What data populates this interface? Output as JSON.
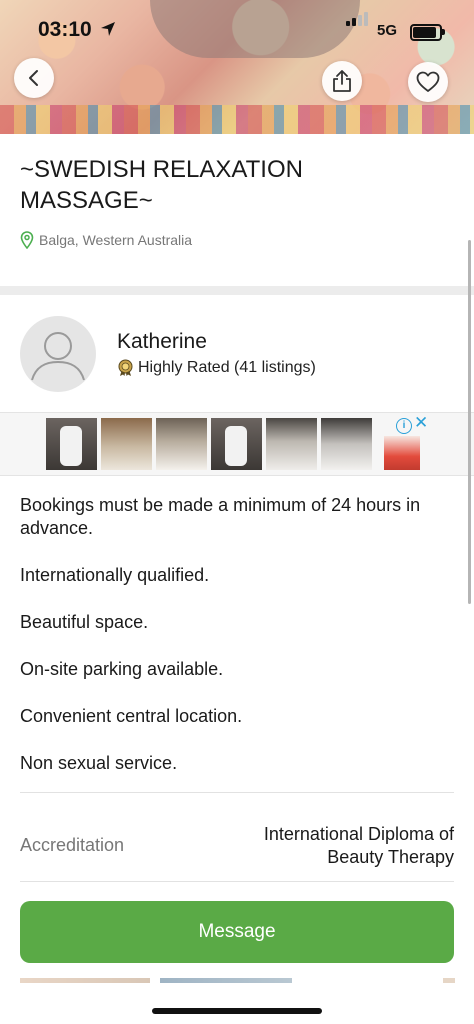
{
  "status_bar": {
    "time": "03:10",
    "network": "5G"
  },
  "listing": {
    "title": "~SWEDISH RELAXATION MASSAGE~",
    "location": "Balga, Western Australia"
  },
  "seller": {
    "name": "Katherine",
    "rating_text": "Highly Rated (41 listings)"
  },
  "ad": {
    "choices_label": "i",
    "close_label": "✕"
  },
  "description": [
    "Bookings must be made a minimum of 24 hours in advance.",
    "Internationally qualified.",
    "Beautiful space.",
    "On-site parking available.",
    "Convenient central location.",
    "Non sexual service."
  ],
  "attributes": {
    "accreditation_label": "Accreditation",
    "accreditation_value": "International Diploma of Beauty Therapy"
  },
  "actions": {
    "message_label": "Message"
  },
  "colors": {
    "accent": "#5aaa46",
    "location_pin": "#4caf50",
    "ad_accent": "#2aa0d8"
  },
  "icons": [
    "back-icon",
    "share-icon",
    "heart-icon",
    "location-pin-icon",
    "award-badge-icon",
    "person-icon",
    "location-arrow-icon"
  ]
}
